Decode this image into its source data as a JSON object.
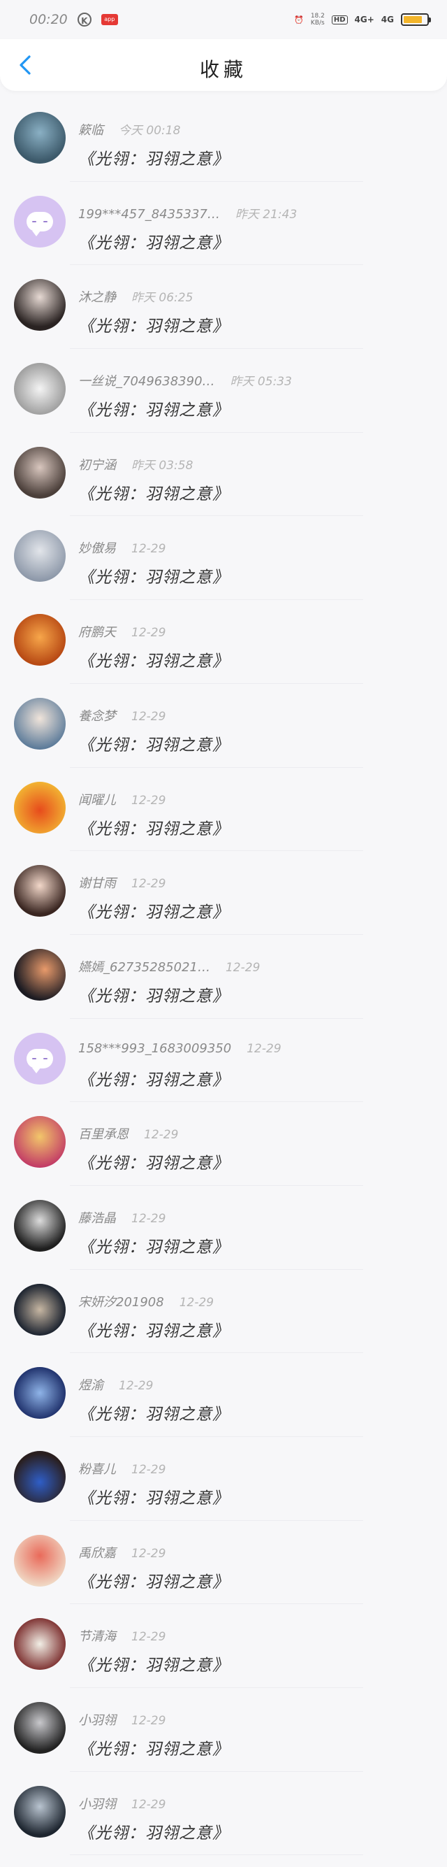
{
  "status_bar": {
    "time": "00:20",
    "k_icon": "K",
    "red_icon": "app",
    "speed_top": "18.2",
    "speed_bottom": "KB/s",
    "hd": "HD",
    "sig1": "4G+",
    "sig2": "4G"
  },
  "header": {
    "title": "收藏"
  },
  "work_title": "《光翎：羽翎之意》",
  "colors": {
    "accent": "#2196f3",
    "avatar_default": "#d6c3f2"
  },
  "items": [
    {
      "name": "簌临",
      "time": "今天 00:18",
      "avatar": "gradient-a"
    },
    {
      "name": "199***457_8435337…",
      "time": "昨天 21:43",
      "avatar": "default"
    },
    {
      "name": "沐之静",
      "time": "昨天 06:25",
      "avatar": "gradient-b"
    },
    {
      "name": "一丝说_7049638390…",
      "time": "昨天 05:33",
      "avatar": "gradient-c"
    },
    {
      "name": "初宁涵",
      "time": "昨天 03:58",
      "avatar": "gradient-d"
    },
    {
      "name": "妙傲易",
      "time": "12-29",
      "avatar": "gradient-e"
    },
    {
      "name": "府鹏天",
      "time": "12-29",
      "avatar": "gradient-f"
    },
    {
      "name": "養念梦",
      "time": "12-29",
      "avatar": "gradient-g"
    },
    {
      "name": "闻曜儿",
      "time": "12-29",
      "avatar": "gradient-h"
    },
    {
      "name": "谢甘雨",
      "time": "12-29",
      "avatar": "gradient-i"
    },
    {
      "name": "嬿嫣_62735285021…",
      "time": "12-29",
      "avatar": "gradient-j"
    },
    {
      "name": "158***993_1683009350",
      "time": "12-29",
      "avatar": "default"
    },
    {
      "name": "百里承恩",
      "time": "12-29",
      "avatar": "gradient-k"
    },
    {
      "name": "藤浩晶",
      "time": "12-29",
      "avatar": "gradient-l"
    },
    {
      "name": "宋妍汐201908",
      "time": "12-29",
      "avatar": "gradient-m"
    },
    {
      "name": "煜渝",
      "time": "12-29",
      "avatar": "gradient-n"
    },
    {
      "name": "粉喜儿",
      "time": "12-29",
      "avatar": "gradient-o"
    },
    {
      "name": "禹欣嘉",
      "time": "12-29",
      "avatar": "gradient-p"
    },
    {
      "name": "节清海",
      "time": "12-29",
      "avatar": "gradient-q"
    },
    {
      "name": "小羽翎",
      "time": "12-29",
      "avatar": "gradient-r"
    },
    {
      "name": "小羽翎",
      "time": "12-29",
      "avatar": "gradient-s"
    }
  ]
}
